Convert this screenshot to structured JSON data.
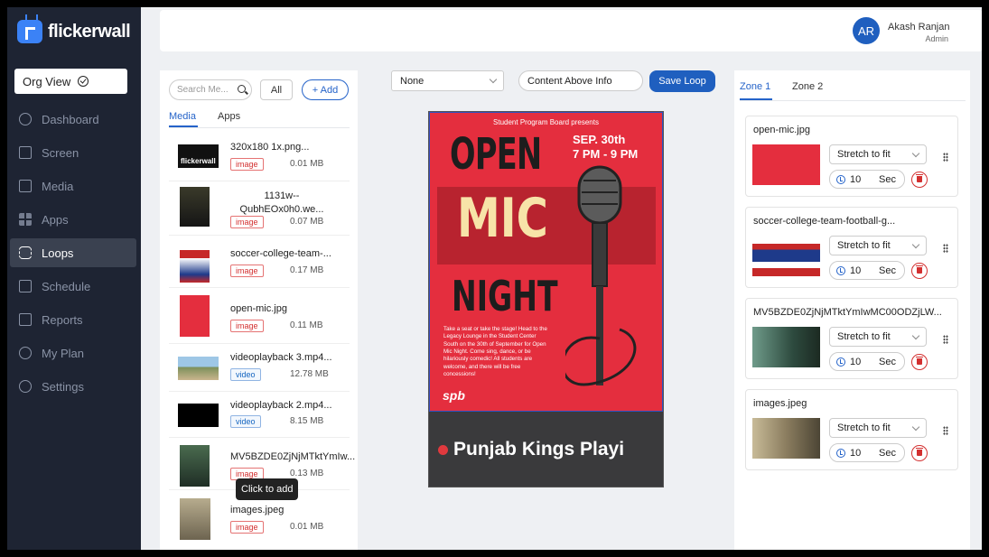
{
  "brand": {
    "name": "flickerwall"
  },
  "org_view": {
    "label": "Org View"
  },
  "nav": [
    {
      "label": "Dashboard",
      "icon": "dashboard-icon"
    },
    {
      "label": "Screen",
      "icon": "monitor-icon"
    },
    {
      "label": "Media",
      "icon": "file-icon"
    },
    {
      "label": "Apps",
      "icon": "grid-icon"
    },
    {
      "label": "Loops",
      "icon": "loop-icon",
      "active": true
    },
    {
      "label": "Schedule",
      "icon": "calendar-icon"
    },
    {
      "label": "Reports",
      "icon": "bar-chart-icon"
    },
    {
      "label": "My Plan",
      "icon": "globe-icon"
    },
    {
      "label": "Settings",
      "icon": "gear-icon"
    }
  ],
  "user": {
    "initials": "AR",
    "name": "Akash Ranjan",
    "role": "Admin"
  },
  "media_panel": {
    "search_placeholder": "Search Me...",
    "filter_label": "All",
    "add_label": "+ Add",
    "tabs": [
      "Media",
      "Apps"
    ],
    "items": [
      {
        "name": "320x180 1x.png...",
        "type": "image",
        "size": "0.01 MB"
      },
      {
        "name": "1131w--QubhEOx0h0.we...",
        "type": "image",
        "size": "0.07 MB"
      },
      {
        "name": "soccer-college-team-...",
        "type": "image",
        "size": "0.17 MB"
      },
      {
        "name": "open-mic.jpg",
        "type": "image",
        "size": "0.11 MB"
      },
      {
        "name": "videoplayback 3.mp4...",
        "type": "video",
        "size": "12.78 MB"
      },
      {
        "name": "videoplayback 2.mp4...",
        "type": "video",
        "size": "8.15 MB"
      },
      {
        "name": "MV5BZDE0ZjNjMTktYmIw...",
        "type": "image",
        "size": "0.13 MB"
      },
      {
        "name": "images.jpeg",
        "type": "image",
        "size": "0.01 MB"
      }
    ],
    "tooltip": "Click to add"
  },
  "toolbar": {
    "transition": "None",
    "layout": "Content Above Info",
    "save_label": "Save Loop"
  },
  "preview": {
    "poster_top": "Student Program Board presents",
    "poster_open": "OPEN",
    "poster_date": "SEP. 30th",
    "poster_time": "7 PM - 9 PM",
    "poster_mic": "MIC",
    "poster_night": "NIGHT",
    "poster_blurb": "Take a seat or take the stage! Head to the Legacy Lounge in the Student Center South on the 30th of September for Open Mic Night. Come sing, dance, or be hilariously comedic! All students are welcome, and there will be free concessions!",
    "poster_footer": "spb",
    "ticker": "Punjab Kings Playi"
  },
  "zones": {
    "tabs": [
      "Zone 1",
      "Zone 2"
    ],
    "items": [
      {
        "name": "open-mic.jpg",
        "fit": "Stretch to fit",
        "duration": "10",
        "unit": "Sec"
      },
      {
        "name": "soccer-college-team-football-g...",
        "fit": "Stretch to fit",
        "duration": "10",
        "unit": "Sec"
      },
      {
        "name": "MV5BZDE0ZjNjMTktYmIwMC00ODZjLW...",
        "fit": "Stretch to fit",
        "duration": "10",
        "unit": "Sec"
      },
      {
        "name": "images.jpeg",
        "fit": "Stretch to fit",
        "duration": "10",
        "unit": "Sec"
      }
    ]
  },
  "colors": {
    "sidebar": "#1e2433",
    "accent": "#1f5fbf",
    "poster_red": "#e42e3e"
  }
}
